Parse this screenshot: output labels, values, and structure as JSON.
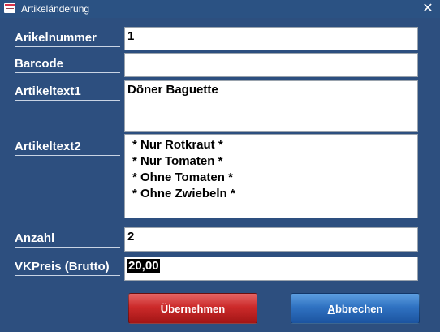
{
  "window": {
    "title": "Artikeländerung",
    "close_glyph": "✕"
  },
  "form": {
    "artikelnummer_label": "Arikelnummer",
    "artikelnummer_value": "1",
    "barcode_label": "Barcode",
    "barcode_value": "",
    "artikeltext1_label": "Artikeltext1",
    "artikeltext1_value": "Döner Baguette",
    "artikeltext2_label": "Artikeltext2",
    "artikeltext2_lines": [
      "* Nur Rotkraut *",
      "* Nur Tomaten *",
      "* Ohne Tomaten *",
      "* Ohne Zwiebeln *"
    ],
    "anzahl_label": "Anzahl",
    "anzahl_value": "2",
    "vkpreis_label": "VKPreis (Brutto)",
    "vkpreis_value": "20,00"
  },
  "buttons": {
    "apply_label": "Übernehmen",
    "cancel_first_letter": "A",
    "cancel_rest": "bbrechen"
  },
  "colors": {
    "background": "#2d4f7f",
    "apply_button": "#cc2a2a",
    "cancel_button": "#2f72c2"
  }
}
